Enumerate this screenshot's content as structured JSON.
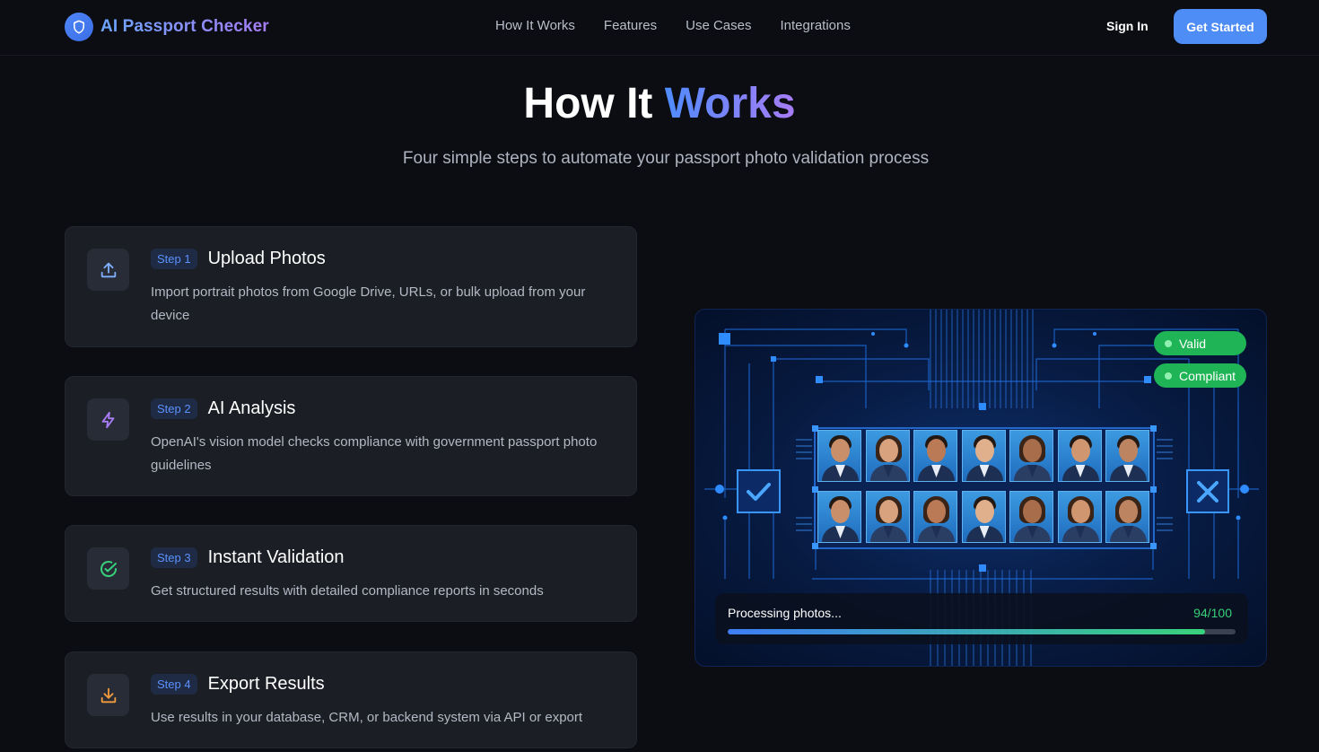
{
  "nav": {
    "brand": "AI Passport Checker",
    "links": [
      "How It Works",
      "Features",
      "Use Cases",
      "Integrations"
    ],
    "sign_in": "Sign In",
    "get_started": "Get Started"
  },
  "hero": {
    "title_plain": "How It ",
    "title_accent": "Works",
    "subtitle": "Four simple steps to automate your passport photo validation process"
  },
  "steps": [
    {
      "badge": "Step 1",
      "title": "Upload Photos",
      "desc": "Import portrait photos from Google Drive, URLs, or bulk upload from your device",
      "icon": "upload-icon",
      "color": "#7fb0ff"
    },
    {
      "badge": "Step 2",
      "title": "AI Analysis",
      "desc": "OpenAI's vision model checks compliance with government passport photo guidelines",
      "icon": "lightning-icon",
      "color": "#a77cf5"
    },
    {
      "badge": "Step 3",
      "title": "Instant Validation",
      "desc": "Get structured results with detailed compliance reports in seconds",
      "icon": "check-circle-icon",
      "color": "#39d27c"
    },
    {
      "badge": "Step 4",
      "title": "Export Results",
      "desc": "Use results in your database, CRM, or backend system via API or export",
      "icon": "download-icon",
      "color": "#f29a3e"
    }
  ],
  "illustration": {
    "tags": [
      "Valid",
      "Compliant"
    ],
    "progress_label": "Processing photos...",
    "progress_count": "94/100",
    "progress_fraction": 0.94
  },
  "colors": {
    "accent": "#4e8cf6",
    "success": "#1fb455",
    "background": "#0b0d12",
    "card": "#1b1e25"
  }
}
